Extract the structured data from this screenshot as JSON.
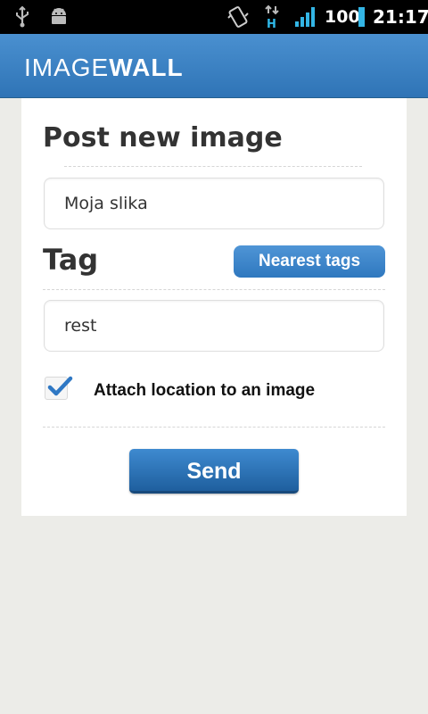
{
  "status_bar": {
    "battery_level": "100",
    "clock": "21:17",
    "icons": [
      "usb-icon",
      "android-debug-icon",
      "vibrate-icon",
      "hspa-data-icon",
      "signal-icon",
      "battery-icon"
    ]
  },
  "app_header": {
    "logo_light": "IMAGE",
    "logo_bold": "WALL",
    "color": "#3a82c4"
  },
  "form": {
    "title": "Post new image",
    "image_name_value": "Moja slika",
    "tag_label": "Tag",
    "nearest_tags_label": "Nearest tags",
    "tag_value": "rest",
    "attach_location_label": "Attach location to an image",
    "attach_location_checked": true,
    "send_label": "Send"
  }
}
